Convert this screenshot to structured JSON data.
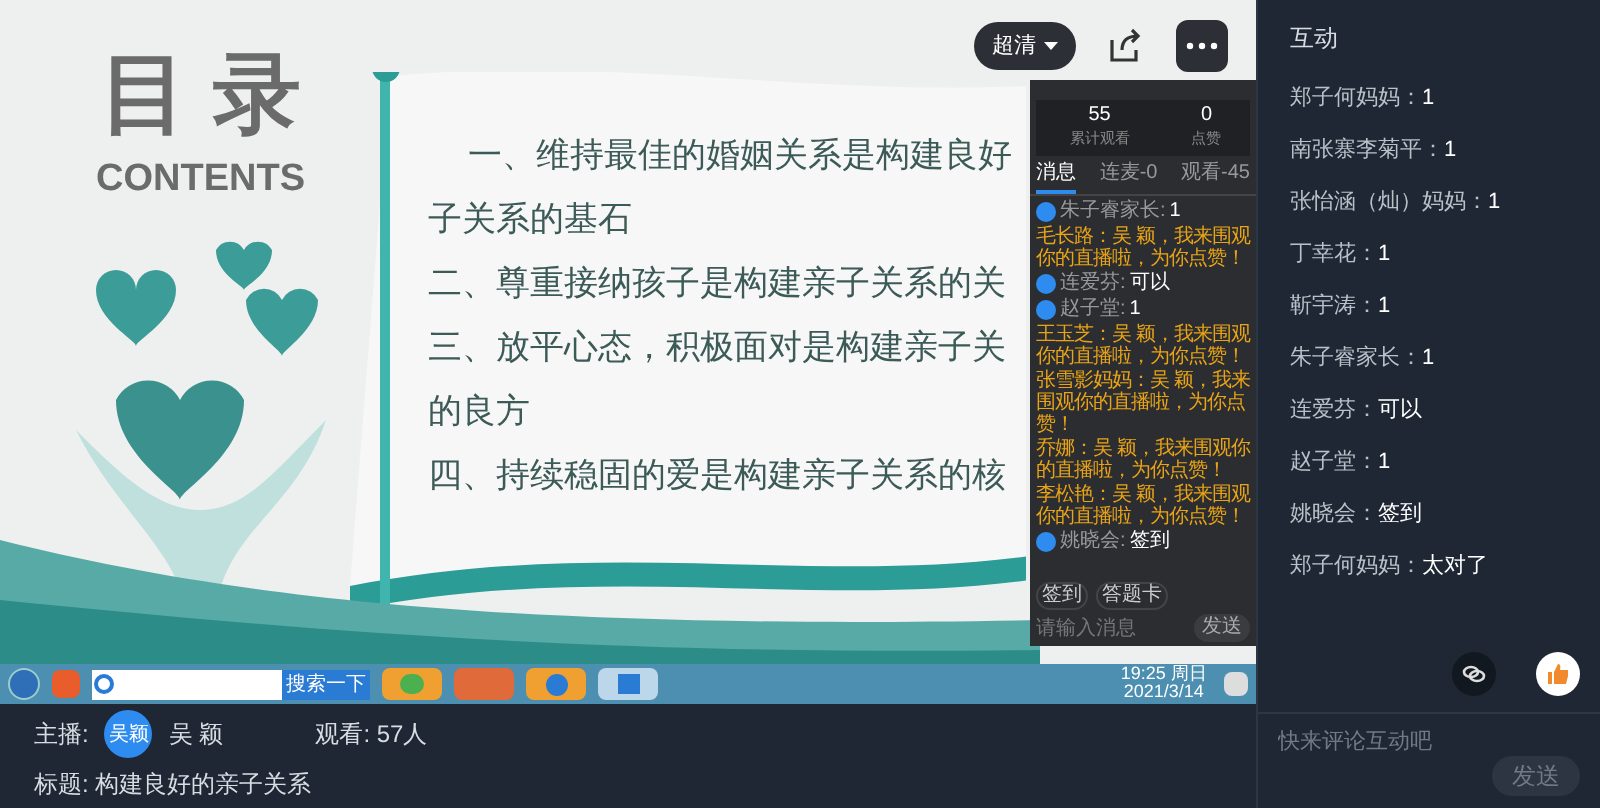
{
  "video": {
    "slide": {
      "title": "目 录",
      "subtitle": "CONTENTS",
      "lines": [
        "一、维持最佳的婚姻关系是构建良好",
        "子关系的基石",
        "二、尊重接纳孩子是构建亲子关系的关",
        "三、放平心态，积极面对是构建亲子关",
        "的良方",
        "四、持续稳固的爱是构建亲子关系的核"
      ]
    },
    "quality_button": "超清",
    "embedded_panel": {
      "stats": [
        {
          "value": "55",
          "label": "累计观看"
        },
        {
          "value": "0",
          "label": "点赞"
        }
      ],
      "tabs": [
        {
          "label": "消息",
          "selected": true
        },
        {
          "label": "连麦-0",
          "selected": false
        },
        {
          "label": "观看-45",
          "selected": false
        }
      ],
      "messages": [
        {
          "kind": "avatar",
          "name": "朱子睿家长:",
          "text": "1"
        },
        {
          "kind": "greeting",
          "text": "毛长路：吴 颖，我来围观你的直播啦，为你点赞！"
        },
        {
          "kind": "avatar",
          "name": "连爱芬:",
          "text": "可以"
        },
        {
          "kind": "avatar",
          "name": "赵子堂:",
          "text": "1"
        },
        {
          "kind": "greeting",
          "text": "王玉芝：吴 颖，我来围观你的直播啦，为你点赞！"
        },
        {
          "kind": "greeting",
          "text": "张雪影妈妈：吴 颖，我来围观你的直播啦，为你点赞！"
        },
        {
          "kind": "greeting",
          "text": "乔娜：吴 颖，我来围观你的直播啦，为你点赞！"
        },
        {
          "kind": "greeting",
          "text": "李松艳：吴 颖，我来围观你的直播啦，为你点赞！"
        },
        {
          "kind": "avatar",
          "name": "姚晓会:",
          "text": "签到"
        }
      ],
      "actions": [
        "签到",
        "答题卡"
      ],
      "placeholder": "请输入消息",
      "send": "发送"
    },
    "taskbar": {
      "search_button": "搜索一下",
      "clock_time": "19:25 周日",
      "clock_date": "2021/3/14"
    }
  },
  "info": {
    "host_label": "主播:",
    "host_avatar": "吴颖",
    "host_name": "吴 颖",
    "viewers": "观看: 57人",
    "title": "标题: 构建良好的亲子关系"
  },
  "sidebar": {
    "title": "互动",
    "comments": [
      {
        "name": "郑子何妈妈：",
        "text": "1"
      },
      {
        "name": "南张寨李菊平：",
        "text": "1"
      },
      {
        "name": "张怡涵（灿）妈妈：",
        "text": "1"
      },
      {
        "name": "丁幸花：",
        "text": "1"
      },
      {
        "name": "靳宇涛：",
        "text": "1"
      },
      {
        "name": "朱子睿家长：",
        "text": "1"
      },
      {
        "name": "连爱芬：",
        "text": "可以"
      },
      {
        "name": "赵子堂：",
        "text": "1"
      },
      {
        "name": "姚晓会：",
        "text": "签到"
      },
      {
        "name": "郑子何妈妈：",
        "text": "太对了"
      }
    ],
    "placeholder": "快来评论互动吧",
    "send": "发送"
  }
}
